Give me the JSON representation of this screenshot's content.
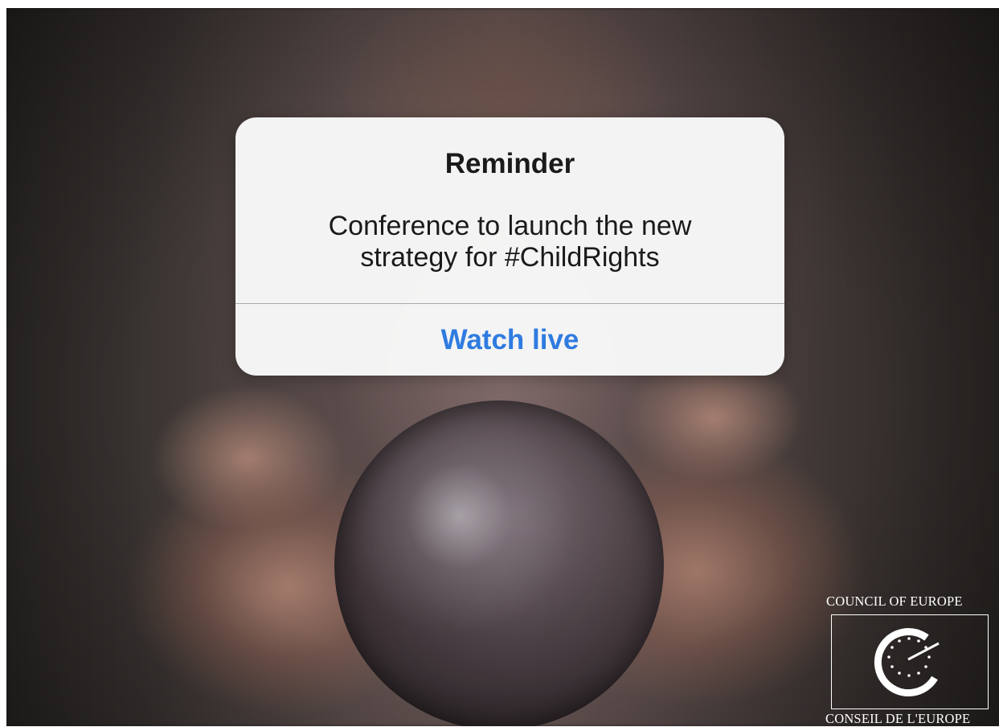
{
  "dialog": {
    "title": "Reminder",
    "message": "Conference to launch the new\nstrategy for #ChildRights",
    "action_label": "Watch live",
    "action_color": "#2f7be0"
  },
  "logo": {
    "top_text": "COUNCIL OF EUROPE",
    "bottom_text": "CONSEIL DE L'EUROPE"
  }
}
